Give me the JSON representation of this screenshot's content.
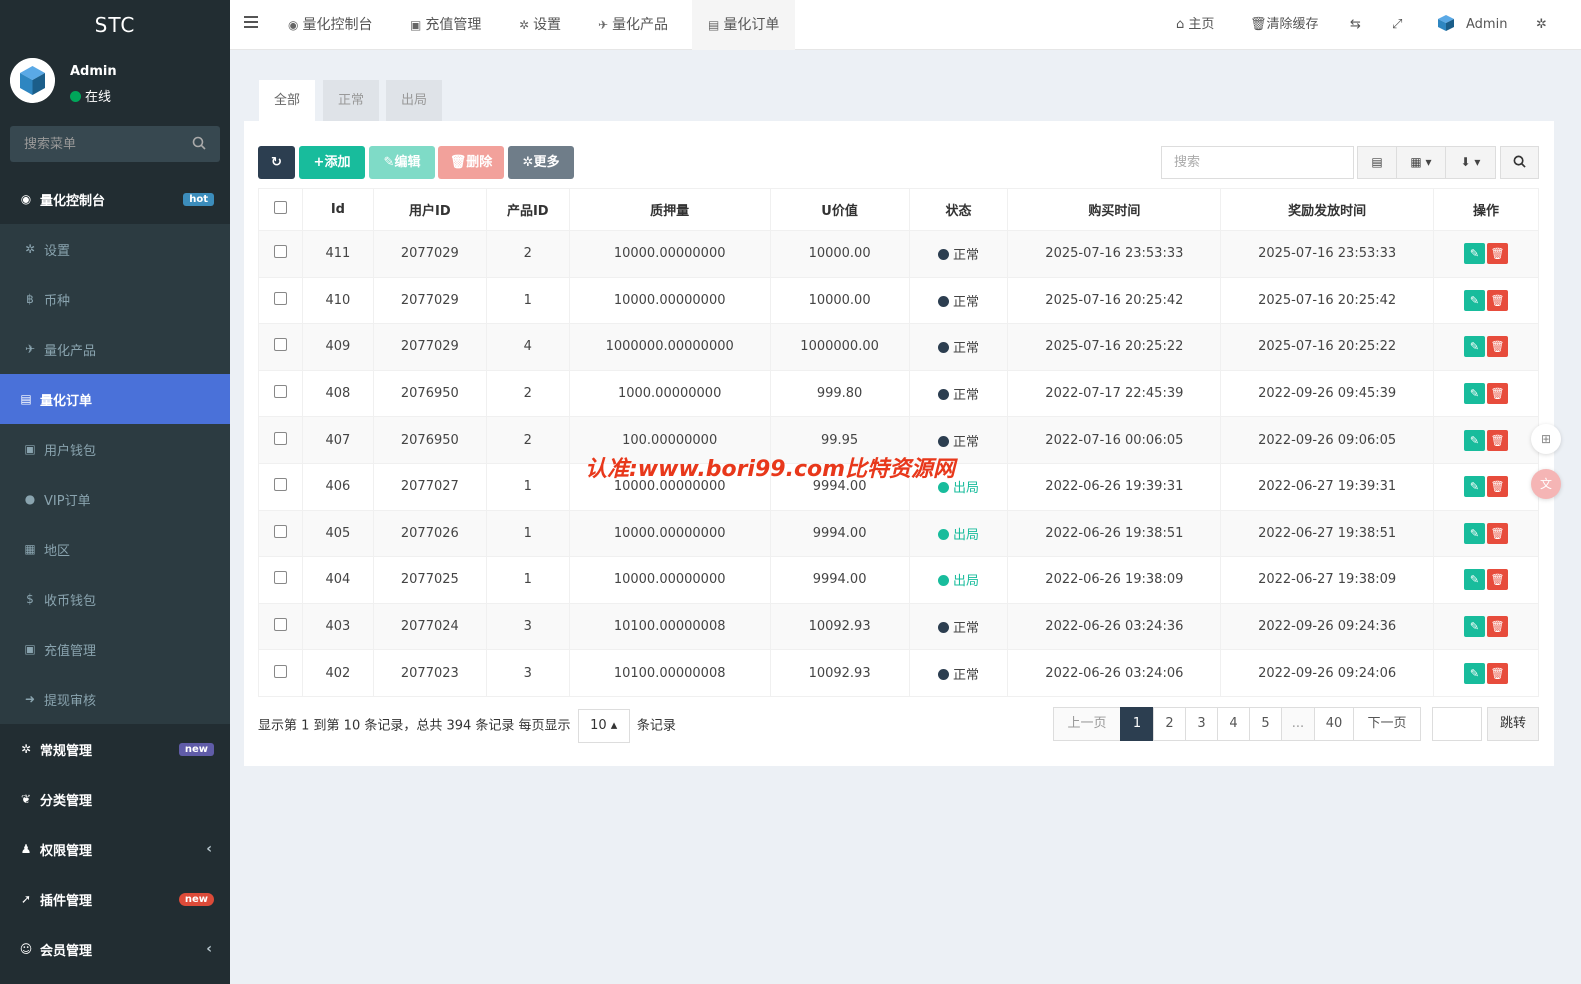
{
  "sidebar": {
    "logo": "STC",
    "user": {
      "name": "Admin",
      "status": "在线"
    },
    "search_placeholder": "搜索菜单",
    "items": [
      {
        "label": "量化控制台",
        "badge": "hot"
      },
      {
        "label": "设置"
      },
      {
        "label": "币种"
      },
      {
        "label": "量化产品"
      },
      {
        "label": "量化订单"
      },
      {
        "label": "用户钱包"
      },
      {
        "label": "VIP订单"
      },
      {
        "label": "地区"
      },
      {
        "label": "收币钱包"
      },
      {
        "label": "充值管理"
      },
      {
        "label": "提现审核"
      },
      {
        "label": "常规管理",
        "badge": "new"
      },
      {
        "label": "分类管理"
      },
      {
        "label": "权限管理"
      },
      {
        "label": "插件管理",
        "badge": "new"
      },
      {
        "label": "会员管理"
      }
    ]
  },
  "header": {
    "tabs": [
      "量化控制台",
      "充值管理",
      "设置",
      "量化产品",
      "量化订单"
    ],
    "right": {
      "home": "主页",
      "clear_cache": "清除缓存",
      "user": "Admin"
    }
  },
  "main": {
    "filter_tabs": [
      "全部",
      "正常",
      "出局"
    ],
    "toolbar": {
      "add": "添加",
      "edit": "编辑",
      "delete": "删除",
      "more": "更多"
    },
    "search_placeholder": "搜索",
    "columns": [
      "Id",
      "用户ID",
      "产品ID",
      "质押量",
      "U价值",
      "状态",
      "购买时间",
      "奖励发放时间",
      "操作"
    ],
    "rows": [
      {
        "id": "411",
        "uid": "2077029",
        "pid": "2",
        "amount": "10000.00000000",
        "uvalue": "10000.00",
        "status": "正常",
        "buy": "2025-07-16 23:53:33",
        "reward": "2025-07-16 23:53:33"
      },
      {
        "id": "410",
        "uid": "2077029",
        "pid": "1",
        "amount": "10000.00000000",
        "uvalue": "10000.00",
        "status": "正常",
        "buy": "2025-07-16 20:25:42",
        "reward": "2025-07-16 20:25:42"
      },
      {
        "id": "409",
        "uid": "2077029",
        "pid": "4",
        "amount": "1000000.00000000",
        "uvalue": "1000000.00",
        "status": "正常",
        "buy": "2025-07-16 20:25:22",
        "reward": "2025-07-16 20:25:22"
      },
      {
        "id": "408",
        "uid": "2076950",
        "pid": "2",
        "amount": "1000.00000000",
        "uvalue": "999.80",
        "status": "正常",
        "buy": "2022-07-17 22:45:39",
        "reward": "2022-09-26 09:45:39"
      },
      {
        "id": "407",
        "uid": "2076950",
        "pid": "2",
        "amount": "100.00000000",
        "uvalue": "99.95",
        "status": "正常",
        "buy": "2022-07-16 00:06:05",
        "reward": "2022-09-26 09:06:05"
      },
      {
        "id": "406",
        "uid": "2077027",
        "pid": "1",
        "amount": "10000.00000000",
        "uvalue": "9994.00",
        "status": "出局",
        "buy": "2022-06-26 19:39:31",
        "reward": "2022-06-27 19:39:31"
      },
      {
        "id": "405",
        "uid": "2077026",
        "pid": "1",
        "amount": "10000.00000000",
        "uvalue": "9994.00",
        "status": "出局",
        "buy": "2022-06-26 19:38:51",
        "reward": "2022-06-27 19:38:51"
      },
      {
        "id": "404",
        "uid": "2077025",
        "pid": "1",
        "amount": "10000.00000000",
        "uvalue": "9994.00",
        "status": "出局",
        "buy": "2022-06-26 19:38:09",
        "reward": "2022-06-27 19:38:09"
      },
      {
        "id": "403",
        "uid": "2077024",
        "pid": "3",
        "amount": "10100.00000008",
        "uvalue": "10092.93",
        "status": "正常",
        "buy": "2022-06-26 03:24:36",
        "reward": "2022-09-26 09:24:36"
      },
      {
        "id": "402",
        "uid": "2077023",
        "pid": "3",
        "amount": "10100.00000008",
        "uvalue": "10092.93",
        "status": "正常",
        "buy": "2022-06-26 03:24:06",
        "reward": "2022-09-26 09:24:06"
      }
    ],
    "footer": {
      "prefix": "显示第 1 到第 10 条记录，总共 394 条记录 每页显示",
      "page_size": "10",
      "suffix": "条记录"
    },
    "pagination": [
      "上一页",
      "1",
      "2",
      "3",
      "4",
      "5",
      "...",
      "40",
      "下一页"
    ],
    "jump_label": "跳转"
  },
  "watermark": "认准:www.bori99.com比特资源网",
  "colors": {
    "sidebar_bg": "#222d32",
    "active": "#4a71d9",
    "success": "#18bc9c",
    "danger": "#e74c3c",
    "dark": "#2c3e50"
  }
}
